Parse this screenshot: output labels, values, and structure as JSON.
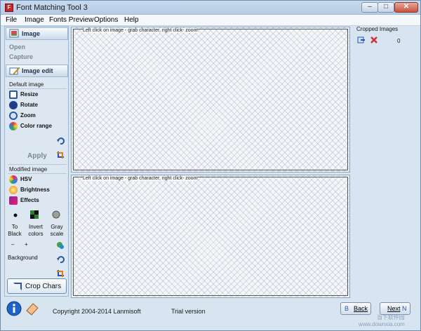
{
  "window": {
    "title": "Font Matching Tool 3",
    "app_icon": "F",
    "controls": {
      "minimize": "–",
      "maximize": "□",
      "close": "✕"
    }
  },
  "menu": [
    "File",
    "Image",
    "Fonts Preview",
    "Options",
    "Help"
  ],
  "left": {
    "image_section": {
      "label": "Image",
      "links": [
        "Open",
        "Capture"
      ]
    },
    "edit_section": {
      "label": "Image edit"
    },
    "default_group": {
      "label": "Default image",
      "tools": [
        "Resize",
        "Rotate",
        "Zoom",
        "Color range"
      ],
      "apply": "Apply"
    },
    "modified_group": {
      "label": "Modified image",
      "tools": [
        "HSV",
        "Brightness",
        "Effects"
      ]
    },
    "conversions": {
      "to_black": "To Black",
      "invert": "Invert colors",
      "gray": "Gray scale"
    },
    "background": {
      "label": "Background",
      "minus": "–",
      "plus": "+"
    },
    "crop": "Crop Chars"
  },
  "canvas_top": {
    "hint": "Left click on image - grab character, right click- zoom"
  },
  "canvas_bottom": {
    "hint": "Left click on image - grab character, right click- zoom"
  },
  "right": {
    "title": "Cropped Images",
    "count": "0"
  },
  "status": {
    "copyright": "Copyright 2004-2014 Lanmisoft",
    "trial": "Trial version",
    "back": "Back",
    "next": "Next",
    "back_key": "B",
    "next_key": "N"
  },
  "watermark": {
    "line1": "当下软件园",
    "line2": "www.downxia.com"
  },
  "colors": {
    "accent": "#2a56a0",
    "close": "#c7533c",
    "panel": "#dde7f1"
  }
}
